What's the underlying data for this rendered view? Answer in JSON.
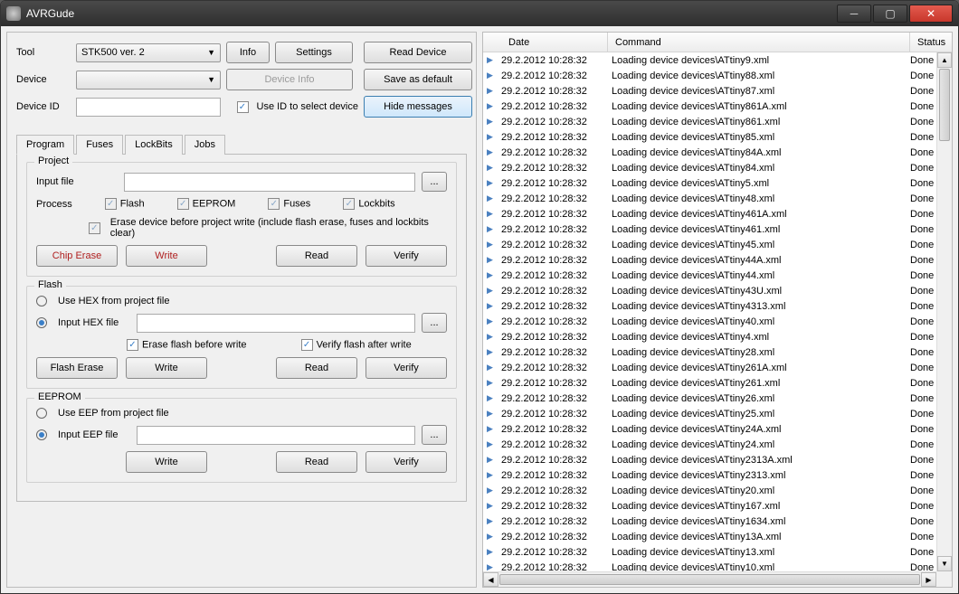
{
  "window": {
    "title": "AVRGude"
  },
  "toolbar": {
    "tool_label": "Tool",
    "tool_value": "STK500 ver. 2",
    "info_label": "Info",
    "settings_label": "Settings",
    "read_device_label": "Read Device",
    "device_label": "Device",
    "device_value": "",
    "device_info_label": "Device Info",
    "save_default_label": "Save as default",
    "device_id_label": "Device ID",
    "device_id_value": "",
    "use_id_label": "Use ID to select device",
    "hide_messages_label": "Hide messages"
  },
  "tabs": {
    "program": "Program",
    "fuses": "Fuses",
    "lockbits": "LockBits",
    "jobs": "Jobs"
  },
  "project": {
    "title": "Project",
    "input_file_label": "Input file",
    "input_file_value": "",
    "process_label": "Process",
    "flash_label": "Flash",
    "eeprom_label": "EEPROM",
    "fuses_label": "Fuses",
    "lockbits_label": "Lockbits",
    "erase_before_label": "Erase device before project write (include flash erase, fuses and lockbits clear)",
    "chip_erase_label": "Chip Erase",
    "write_label": "Write",
    "read_label": "Read",
    "verify_label": "Verify"
  },
  "flash": {
    "title": "Flash",
    "use_hex_label": "Use HEX from project file",
    "input_hex_label": "Input HEX file",
    "input_hex_value": "",
    "erase_before_label": "Erase flash before write",
    "verify_after_label": "Verify flash after write",
    "flash_erase_label": "Flash Erase",
    "write_label": "Write",
    "read_label": "Read",
    "verify_label": "Verify"
  },
  "eeprom": {
    "title": "EEPROM",
    "use_eep_label": "Use EEP from project file",
    "input_eep_label": "Input EEP file",
    "input_eep_value": "",
    "write_label": "Write",
    "read_label": "Read",
    "verify_label": "Verify"
  },
  "browse_label": "...",
  "log": {
    "headers": {
      "date": "Date",
      "command": "Command",
      "status": "Status"
    },
    "rows": [
      {
        "date": "29.2.2012 10:28:32",
        "command": "Loading device devices\\ATtiny9.xml",
        "status": "Done"
      },
      {
        "date": "29.2.2012 10:28:32",
        "command": "Loading device devices\\ATtiny88.xml",
        "status": "Done"
      },
      {
        "date": "29.2.2012 10:28:32",
        "command": "Loading device devices\\ATtiny87.xml",
        "status": "Done"
      },
      {
        "date": "29.2.2012 10:28:32",
        "command": "Loading device devices\\ATtiny861A.xml",
        "status": "Done"
      },
      {
        "date": "29.2.2012 10:28:32",
        "command": "Loading device devices\\ATtiny861.xml",
        "status": "Done"
      },
      {
        "date": "29.2.2012 10:28:32",
        "command": "Loading device devices\\ATtiny85.xml",
        "status": "Done"
      },
      {
        "date": "29.2.2012 10:28:32",
        "command": "Loading device devices\\ATtiny84A.xml",
        "status": "Done"
      },
      {
        "date": "29.2.2012 10:28:32",
        "command": "Loading device devices\\ATtiny84.xml",
        "status": "Done"
      },
      {
        "date": "29.2.2012 10:28:32",
        "command": "Loading device devices\\ATtiny5.xml",
        "status": "Done"
      },
      {
        "date": "29.2.2012 10:28:32",
        "command": "Loading device devices\\ATtiny48.xml",
        "status": "Done"
      },
      {
        "date": "29.2.2012 10:28:32",
        "command": "Loading device devices\\ATtiny461A.xml",
        "status": "Done"
      },
      {
        "date": "29.2.2012 10:28:32",
        "command": "Loading device devices\\ATtiny461.xml",
        "status": "Done"
      },
      {
        "date": "29.2.2012 10:28:32",
        "command": "Loading device devices\\ATtiny45.xml",
        "status": "Done"
      },
      {
        "date": "29.2.2012 10:28:32",
        "command": "Loading device devices\\ATtiny44A.xml",
        "status": "Done"
      },
      {
        "date": "29.2.2012 10:28:32",
        "command": "Loading device devices\\ATtiny44.xml",
        "status": "Done"
      },
      {
        "date": "29.2.2012 10:28:32",
        "command": "Loading device devices\\ATtiny43U.xml",
        "status": "Done"
      },
      {
        "date": "29.2.2012 10:28:32",
        "command": "Loading device devices\\ATtiny4313.xml",
        "status": "Done"
      },
      {
        "date": "29.2.2012 10:28:32",
        "command": "Loading device devices\\ATtiny40.xml",
        "status": "Done"
      },
      {
        "date": "29.2.2012 10:28:32",
        "command": "Loading device devices\\ATtiny4.xml",
        "status": "Done"
      },
      {
        "date": "29.2.2012 10:28:32",
        "command": "Loading device devices\\ATtiny28.xml",
        "status": "Done"
      },
      {
        "date": "29.2.2012 10:28:32",
        "command": "Loading device devices\\ATtiny261A.xml",
        "status": "Done"
      },
      {
        "date": "29.2.2012 10:28:32",
        "command": "Loading device devices\\ATtiny261.xml",
        "status": "Done"
      },
      {
        "date": "29.2.2012 10:28:32",
        "command": "Loading device devices\\ATtiny26.xml",
        "status": "Done"
      },
      {
        "date": "29.2.2012 10:28:32",
        "command": "Loading device devices\\ATtiny25.xml",
        "status": "Done"
      },
      {
        "date": "29.2.2012 10:28:32",
        "command": "Loading device devices\\ATtiny24A.xml",
        "status": "Done"
      },
      {
        "date": "29.2.2012 10:28:32",
        "command": "Loading device devices\\ATtiny24.xml",
        "status": "Done"
      },
      {
        "date": "29.2.2012 10:28:32",
        "command": "Loading device devices\\ATtiny2313A.xml",
        "status": "Done"
      },
      {
        "date": "29.2.2012 10:28:32",
        "command": "Loading device devices\\ATtiny2313.xml",
        "status": "Done"
      },
      {
        "date": "29.2.2012 10:28:32",
        "command": "Loading device devices\\ATtiny20.xml",
        "status": "Done"
      },
      {
        "date": "29.2.2012 10:28:32",
        "command": "Loading device devices\\ATtiny167.xml",
        "status": "Done"
      },
      {
        "date": "29.2.2012 10:28:32",
        "command": "Loading device devices\\ATtiny1634.xml",
        "status": "Done"
      },
      {
        "date": "29.2.2012 10:28:32",
        "command": "Loading device devices\\ATtiny13A.xml",
        "status": "Done"
      },
      {
        "date": "29.2.2012 10:28:32",
        "command": "Loading device devices\\ATtiny13.xml",
        "status": "Done"
      },
      {
        "date": "29.2.2012 10:28:32",
        "command": "Loading device devices\\ATtiny10.xml",
        "status": "Done"
      }
    ]
  }
}
